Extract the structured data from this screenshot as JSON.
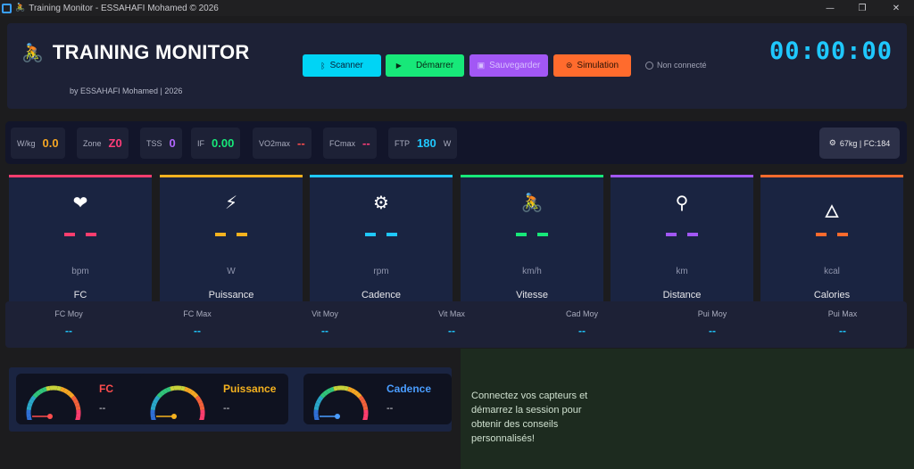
{
  "window": {
    "title": "Training Monitor - ESSAHAFI Mohamed © 2026",
    "controls": {
      "minimize": "—",
      "maximize": "❐",
      "close": "✕"
    }
  },
  "header": {
    "app_title": "TRAINING MONITOR",
    "byline": "by ESSAHAFI Mohamed | 2026",
    "buttons": {
      "scan": "Scanner",
      "start": "Démarrer",
      "save": "Sauvegarder",
      "simulate": "Simulation"
    },
    "connection_status": "Non connecté",
    "timer": "00:00:00"
  },
  "stats": [
    {
      "label": "W/kg",
      "value": "0.0",
      "color": "#f5a623"
    },
    {
      "label": "Zone",
      "value": "Z0",
      "color": "#ff3d7a"
    },
    {
      "label": "TSS",
      "value": "0",
      "color": "#b267ff"
    },
    {
      "label": "IF",
      "value": "0.00",
      "color": "#17e879"
    },
    {
      "label": "VO2max",
      "value": "--",
      "color": "#ff4d4d"
    },
    {
      "label": "FCmax",
      "value": "--",
      "color": "#ff3d7a"
    },
    {
      "label": "FTP",
      "value": "180",
      "unit": "W",
      "color": "#1fc8ff"
    }
  ],
  "profile": "67kg | FC:184",
  "metrics": [
    {
      "name": "FC",
      "unit": "bpm",
      "icon": "heart-icon",
      "value": "--",
      "color": "#ff3d6e"
    },
    {
      "name": "Puissance",
      "unit": "W",
      "icon": "lightning-icon",
      "value": "--",
      "color": "#f5b21f"
    },
    {
      "name": "Cadence",
      "unit": "rpm",
      "icon": "gear-icon",
      "value": "--",
      "color": "#1fc8ff"
    },
    {
      "name": "Vitesse",
      "unit": "km/h",
      "icon": "cyclist-icon",
      "value": "--",
      "color": "#17e879"
    },
    {
      "name": "Distance",
      "unit": "km",
      "icon": "pin-icon",
      "value": "--",
      "color": "#a257f5"
    },
    {
      "name": "Calories",
      "unit": "kcal",
      "icon": "flame-icon",
      "value": "--",
      "color": "#ff6b2d"
    }
  ],
  "averages": [
    {
      "label": "FC Moy",
      "value": "--"
    },
    {
      "label": "FC Max",
      "value": "--"
    },
    {
      "label": "Vit Moy",
      "value": "--"
    },
    {
      "label": "Vit Max",
      "value": "--"
    },
    {
      "label": "Cad Moy",
      "value": "--"
    },
    {
      "label": "Pui Moy",
      "value": "--"
    },
    {
      "label": "Pui Max",
      "value": "--"
    }
  ],
  "gauges": [
    {
      "name": "FC",
      "value": "--",
      "color": "#ff4d4d",
      "level": 0
    },
    {
      "name": "Puissance",
      "value": "--",
      "color": "#f5b21f",
      "level": 0
    },
    {
      "name": "Cadence",
      "value": "--",
      "color": "#4a9dff",
      "level": 0
    }
  ],
  "advice": "Connectez vos capteurs et démarrez la session pour obtenir des conseils personnalisés!"
}
